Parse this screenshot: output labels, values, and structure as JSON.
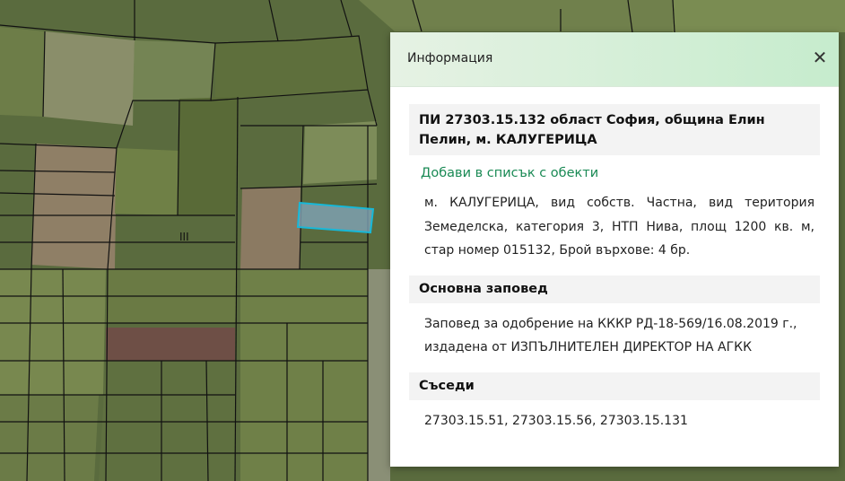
{
  "map": {
    "colors": {
      "base": "#5a6b3e",
      "field_light": "#7f8f5a",
      "field_dark": "#4e5f35",
      "field_brown": "#8b7a62",
      "field_red": "#6e4f46",
      "boundary": "#111111",
      "selected_outline": "#17b8d8",
      "selected_fill": "#7fa4b8"
    },
    "map_label": "III"
  },
  "panel": {
    "title": "Информация",
    "close_glyph": "✕",
    "parcel_title": "ПИ 27303.15.132 област София, община Елин Пелин, м. КАЛУГЕРИЦА",
    "add_link": "Добави в списък с обекти",
    "description": "м. КАЛУГЕРИЦА, вид собств. Частна, вид територия Земеделска, категория 3, НТП Нива, площ 1200 кв. м, стар номер 015132, Брой върхове: 4 бр.",
    "order_heading": "Основна заповед",
    "order_text": "Заповед за одобрение на КККР РД-18-569/16.08.2019 г., издадена от ИЗПЪЛНИТЕЛЕН ДИРЕКТОР НА АГКК",
    "neighbors_heading": "Съседи",
    "neighbors_text": "27303.15.51, 27303.15.56, 27303.15.131"
  }
}
